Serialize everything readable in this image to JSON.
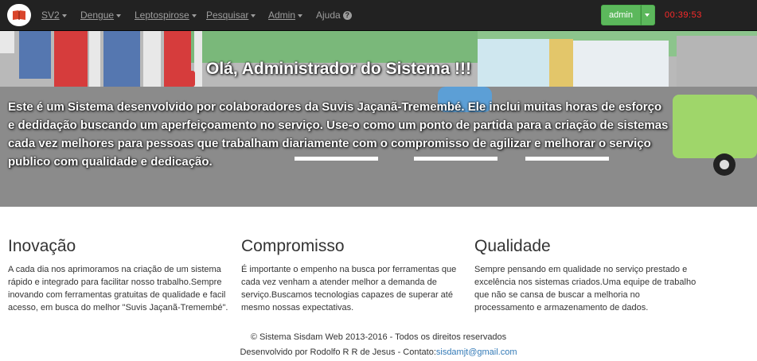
{
  "navbar": {
    "brand_icon": "book-icon",
    "menu": [
      {
        "label": "SV2"
      },
      {
        "label": "Dengue"
      },
      {
        "label": "Leptospirose"
      },
      {
        "label": "Pesquisar"
      },
      {
        "label": "Admin"
      }
    ],
    "help": {
      "label": "Ajuda",
      "icon": "question-circle-icon"
    },
    "user_button": {
      "label": "admin",
      "color": "#5cb85c"
    },
    "timer": {
      "value": "00:39:53",
      "color": "#ff2a2a"
    }
  },
  "hero": {
    "title": "Olá, Administrador do Sistema !!!",
    "text": "Este é um Sistema desenvolvido por colaboradores da Suvis Jaçanã-Tremembé. Ele inclui muitas horas de esforço e dedidação buscando um aperfeiçoamento no serviço. Use-o como um ponto de partida para a criação de sistemas cada vez melhores para pessoas que trabalham diariamente com o compromisso de agilizar e melhorar o serviço publico com qualidade e dedicação."
  },
  "columns": [
    {
      "title": "Inovação",
      "text": "A cada dia nos aprimoramos na criação de um sistema rápido e integrado para facilitar nosso trabalho.Sempre inovando com ferramentas gratuitas de qualidade e facil acesso, em busca do melhor \"Suvis Jaçanã-Tremembé\"."
    },
    {
      "title": "Compromisso",
      "text": "É importante o empenho na busca por ferramentas que cada vez venham a atender melhor a demanda de serviço.Buscamos tecnologias capazes de superar até mesmo nossas expectativas."
    },
    {
      "title": "Qualidade",
      "text": "Sempre pensando em qualidade no serviço prestado e excelência nos sistemas criados.Uma equipe de trabalho que não se cansa de buscar a melhoria no processamento e armazenamento de dados."
    }
  ],
  "footer": {
    "copyright": "© Sistema Sisdam Web 2013-2016 - Todos os direitos reservados",
    "dev_prefix": "Desenvolvido por Rodolfo R R de Jesus - Contato:",
    "email": "sisdamjt@gmail.com"
  }
}
